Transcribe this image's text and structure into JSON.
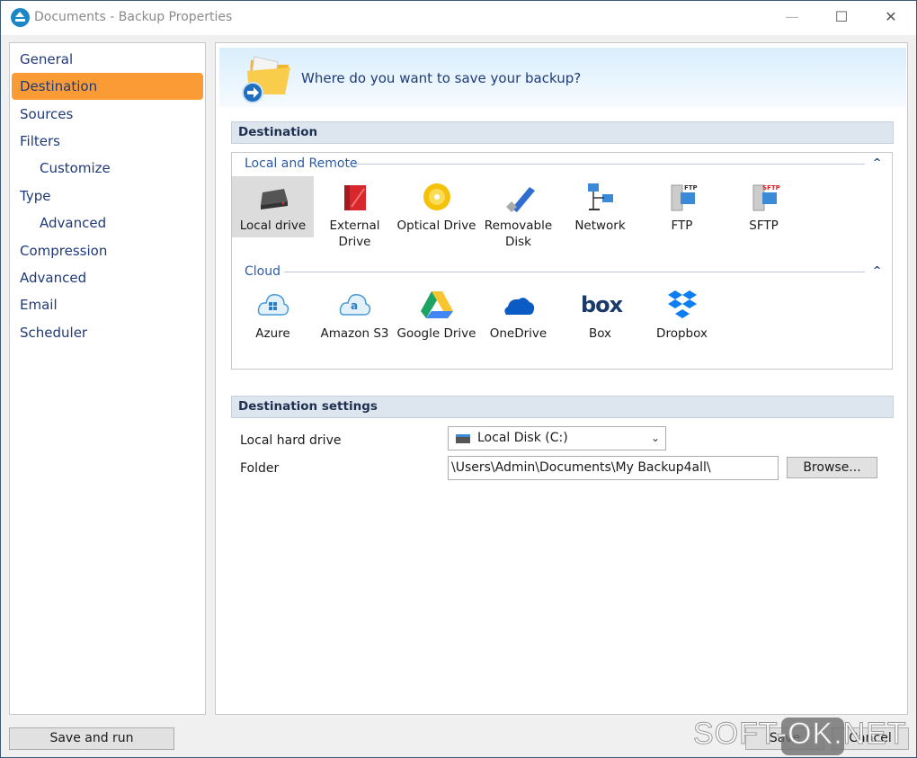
{
  "window": {
    "title": "Documents - Backup Properties",
    "minimize": "—",
    "maximize": "☐",
    "close": "✕"
  },
  "sidebar": {
    "items": [
      {
        "label": "General"
      },
      {
        "label": "Destination",
        "active": true
      },
      {
        "label": "Sources"
      },
      {
        "label": "Filters"
      },
      {
        "label": "Customize",
        "sub": true
      },
      {
        "label": "Type"
      },
      {
        "label": "Advanced",
        "sub": true
      },
      {
        "label": "Compression"
      },
      {
        "label": "Advanced"
      },
      {
        "label": "Email"
      },
      {
        "label": "Scheduler"
      }
    ]
  },
  "header": {
    "question": "Where do you want to save your backup?"
  },
  "destination": {
    "section_title": "Destination",
    "local_group": "Local and Remote",
    "local_items": [
      {
        "label": "Local drive",
        "icon": "hard-drive-icon",
        "selected": true
      },
      {
        "label": "External Drive",
        "icon": "external-drive-icon"
      },
      {
        "label": "Optical Drive",
        "icon": "optical-disc-icon"
      },
      {
        "label": "Removable Disk",
        "icon": "usb-stick-icon"
      },
      {
        "label": "Network",
        "icon": "network-icon"
      },
      {
        "label": "FTP",
        "icon": "ftp-server-icon"
      },
      {
        "label": "SFTP",
        "icon": "sftp-server-icon"
      }
    ],
    "cloud_group": "Cloud",
    "cloud_items": [
      {
        "label": "Azure",
        "icon": "azure-icon"
      },
      {
        "label": "Amazon S3",
        "icon": "amazon-s3-icon"
      },
      {
        "label": "Google Drive",
        "icon": "google-drive-icon"
      },
      {
        "label": "OneDrive",
        "icon": "onedrive-icon"
      },
      {
        "label": "Box",
        "icon": "box-icon"
      },
      {
        "label": "Dropbox",
        "icon": "dropbox-icon"
      }
    ],
    "box_logo_text": "box",
    "ftp_badge": "FTP",
    "sftp_badge": "SFTP"
  },
  "settings": {
    "section_title": "Destination settings",
    "drive_label": "Local hard drive",
    "drive_value": "Local Disk (C:)",
    "folder_label": "Folder",
    "folder_value": "\\Users\\Admin\\Documents\\My Backup4all\\",
    "browse": "Browse..."
  },
  "footer": {
    "save_and_run": "Save and run",
    "save": "Save",
    "cancel": "Cancel"
  },
  "watermark": "SOFT-OK.NET",
  "colors": {
    "accent": "#fb9b35",
    "nav_text": "#1f3a78",
    "group_text": "#2d5aa8"
  }
}
